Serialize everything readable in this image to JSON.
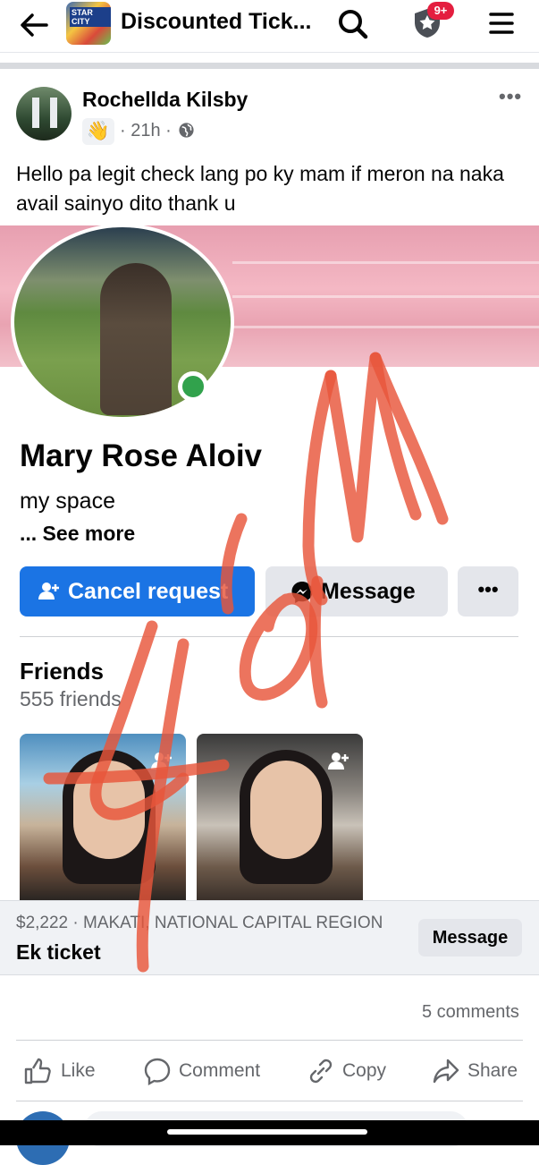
{
  "topbar": {
    "back_icon": "arrow-left-icon",
    "group_thumb_text": "STAR CITY",
    "title": "Discounted Tick...",
    "search_icon": "search-icon",
    "star_icon": "star-badge-icon",
    "badge_count": "9+",
    "menu_icon": "hamburger-menu-icon"
  },
  "post": {
    "author": "Rochellda Kilsby",
    "badge_icon": "waving-hand-icon",
    "badge_emoji": "👋",
    "time": "· 21h ·",
    "privacy_icon": "globe-icon",
    "more": "•••",
    "text": "Hello pa legit check lang po ky mam if meron na naka avail sainyo dito thank u"
  },
  "profile_screenshot": {
    "name": "Mary Rose Aloiv",
    "bio": "my space",
    "see_more": "... See more",
    "cancel_request": "Cancel request",
    "message": "Message",
    "more": "•••",
    "friends_heading": "Friends",
    "friends_count": "555 friends",
    "online_color": "#31a24c",
    "primary_color": "#1b74e4"
  },
  "marketplace": {
    "meta": "$2,222 · MAKATI, NATIONAL CAPITAL REGION",
    "title": "Ek ticket",
    "message_button": "Message"
  },
  "engagement": {
    "comments": "5 comments",
    "like": "Like",
    "comment": "Comment",
    "copy": "Copy",
    "share": "Share"
  },
  "overlay": {
    "scribble_color": "#e8553a"
  }
}
